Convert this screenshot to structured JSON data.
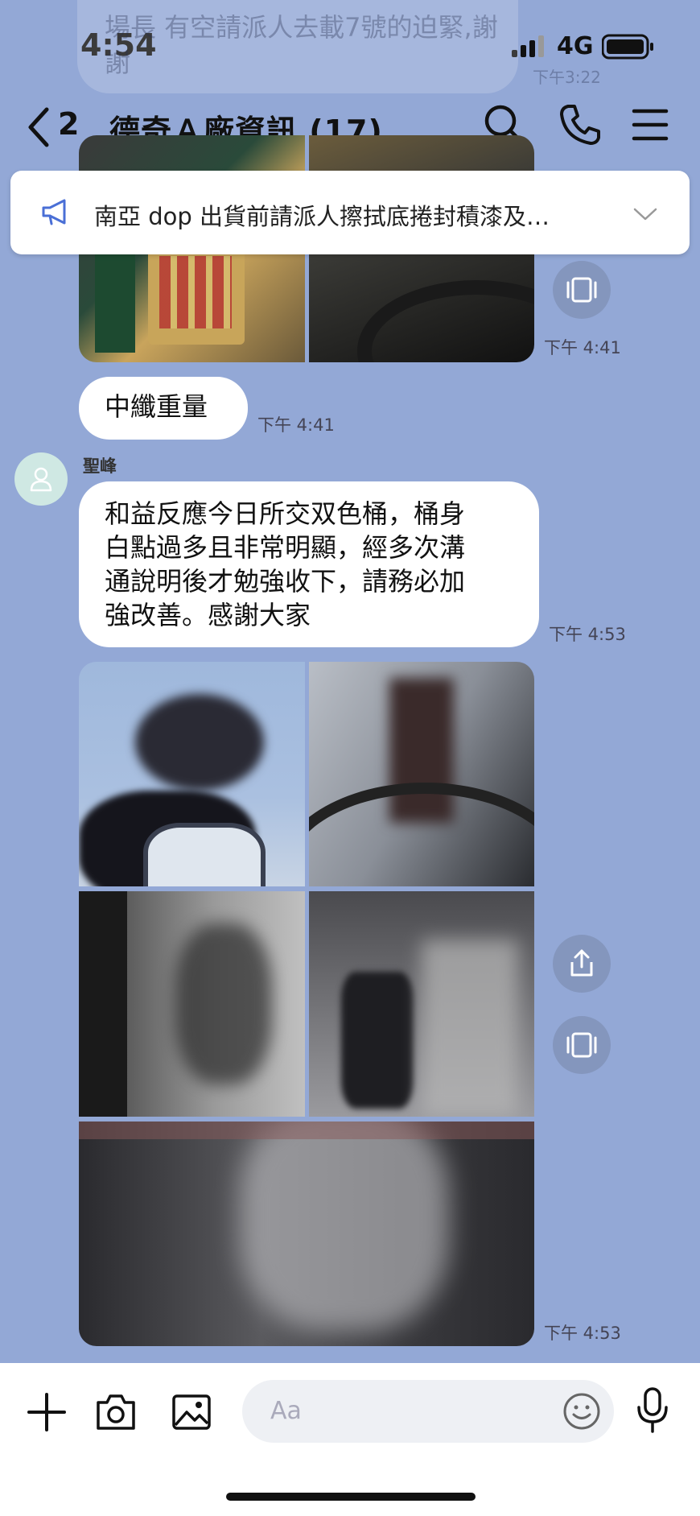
{
  "status_bar": {
    "time": "4:54",
    "network": "4G"
  },
  "prev_message": {
    "text": "場長  有空請派人去載7號的迫緊,謝謝",
    "time": "下午3:22"
  },
  "header": {
    "back_count": "2",
    "title": "德奇Ａ廠資訊 (17)"
  },
  "announcement": {
    "text": "南亞 dop 出貨前請派人擦拭底捲封積漆及…"
  },
  "messages": [
    {
      "time": "下午 4:41"
    },
    {
      "text": "中纖重量",
      "time": "下午 4:41"
    },
    {
      "sender": "聖峰",
      "lines": [
        "和益反應今日所交双色桶，桶身",
        "白點過多且非常明顯，經多次溝",
        "通說明後才勉強收下，請務必加",
        "強改善。感謝大家"
      ],
      "time": "下午 4:53"
    },
    {
      "time": "下午 4:53"
    }
  ],
  "input": {
    "placeholder": "Aa"
  },
  "colors": {
    "background": "#93a8d6",
    "accent": "#4a6fd6"
  }
}
